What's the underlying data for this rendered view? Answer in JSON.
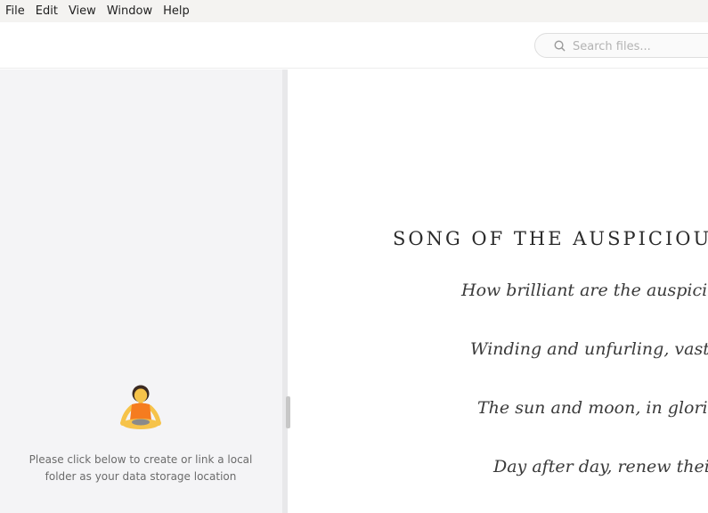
{
  "menubar": {
    "items": [
      "File",
      "Edit",
      "View",
      "Window",
      "Help"
    ]
  },
  "search": {
    "placeholder": "Search files...",
    "icon": "search-icon"
  },
  "sidebar": {
    "empty_icon": "person-in-lotus-position-icon",
    "empty_message": "Please click below to create or link a local folder as your data storage location"
  },
  "poem": {
    "title": "SONG OF THE AUSPICIOU",
    "lines": [
      "How brilliant are the auspicio",
      "Winding and unfurling, vast a",
      "The sun and moon, in glorio",
      "Day after day, renew their"
    ]
  }
}
